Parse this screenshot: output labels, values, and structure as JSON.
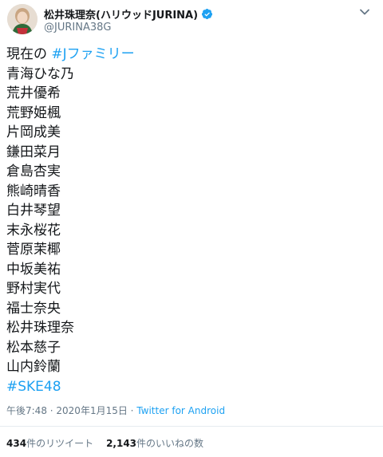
{
  "user": {
    "display_name": "松井珠理奈(ハリウッドJURINA)",
    "handle": "@JURINA38G",
    "verified": true
  },
  "tweet": {
    "intro": "現在の",
    "intro_hashtag": "#Jファミリー",
    "members": [
      "青海ひな乃",
      "荒井優希",
      "荒野姫楓",
      "片岡成美",
      "鎌田菜月",
      "倉島杏実",
      "熊崎晴香",
      "白井琴望",
      "末永桜花",
      "菅原茉椰",
      "中坂美祐",
      "野村実代",
      "福士奈央",
      "松井珠理奈",
      "松本慈子",
      "山内鈴蘭"
    ],
    "closing_hashtag": "#SKE48"
  },
  "meta": {
    "time": "午後7:48",
    "separator": " · ",
    "date": "2020年1月15日",
    "source": "Twitter for Android"
  },
  "stats": {
    "retweets_count": "434",
    "retweets_label": "件のリツイート",
    "likes_count": "2,143",
    "likes_label": "件のいいねの数"
  },
  "colors": {
    "accent": "#1da1f2",
    "muted": "#657786",
    "text": "#14171a"
  },
  "icons": {
    "verified": "verified-badge-icon",
    "menu": "chevron-down-icon"
  }
}
